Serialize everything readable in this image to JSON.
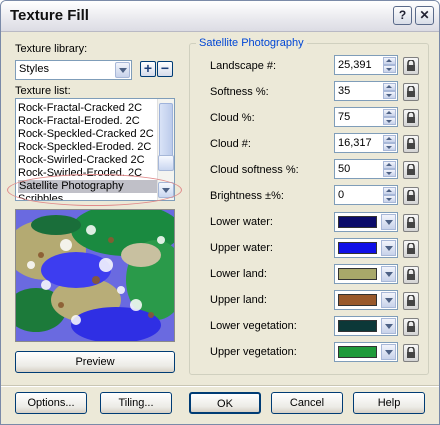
{
  "window": {
    "title": "Texture Fill"
  },
  "titlebar": {
    "help_glyph": "?",
    "close_glyph": "✕"
  },
  "library": {
    "label": "Texture library:",
    "selected": "Styles",
    "add_glyph": "+",
    "remove_glyph": "−"
  },
  "texture_list": {
    "label": "Texture list:",
    "items": [
      "Rock-Fractal-Cracked 2C",
      "Rock-Fractal-Eroded. 2C",
      "Rock-Speckled-Cracked 2C",
      "Rock-Speckled-Eroded. 2C",
      "Rock-Swirled-Cracked 2C",
      "Rock-Swirled-Eroded. 2C",
      "Satellite Photography",
      "Scribbles"
    ],
    "selected_index": 6
  },
  "preview_button": "Preview",
  "group": {
    "title": "Satellite Photography"
  },
  "params": [
    {
      "label": "Landscape #:",
      "value": "25,391"
    },
    {
      "label": "Softness %:",
      "value": "35"
    },
    {
      "label": "Cloud %:",
      "value": "75"
    },
    {
      "label": "Cloud #:",
      "value": "16,317"
    },
    {
      "label": "Cloud softness %:",
      "value": "50"
    },
    {
      "label": "Brightness ±%:",
      "value": "0"
    }
  ],
  "colors": [
    {
      "label": "Lower water:",
      "color": "#0b0b6a"
    },
    {
      "label": "Upper water:",
      "color": "#1010e6"
    },
    {
      "label": "Lower land:",
      "color": "#a8a86a"
    },
    {
      "label": "Upper land:",
      "color": "#9a5a2c"
    },
    {
      "label": "Lower vegetation:",
      "color": "#0c3838"
    },
    {
      "label": "Upper vegetation:",
      "color": "#1f9a3a"
    }
  ],
  "bottom_buttons": {
    "options": "Options...",
    "tiling": "Tiling...",
    "ok": "OK",
    "cancel": "Cancel",
    "help": "Help"
  }
}
